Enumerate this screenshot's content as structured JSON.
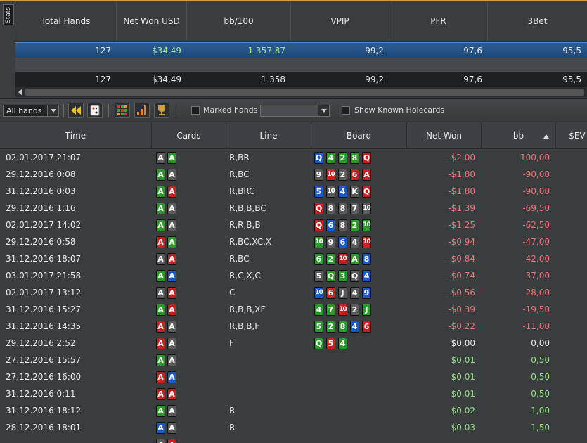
{
  "stats_tab": "Stats",
  "stats": {
    "columns": [
      "Total Hands",
      "Net Won USD",
      "bb/100",
      "VPIP",
      "PFR",
      "3Bet"
    ],
    "row1": [
      "127",
      "$34,49",
      "1 357,87",
      "99,2",
      "97,6",
      "95,5"
    ],
    "row2": [
      "127",
      "$34,49",
      "1 358",
      "99,2",
      "97,6",
      "95,5"
    ]
  },
  "toolbar": {
    "filter_value": "All hands",
    "marked_hands_label": "Marked hands",
    "marked_hands_value": "",
    "show_known_label": "Show Known Holecards"
  },
  "table": {
    "columns": [
      "Time",
      "Cards",
      "Line",
      "Board",
      "Net Won",
      "bb",
      "$EV"
    ],
    "rows": [
      {
        "time": "02.01.2017 21:07",
        "cards": [
          [
            "A",
            "s"
          ],
          [
            "A",
            "c"
          ]
        ],
        "line": "R,BR",
        "board": [
          [
            "Q",
            "d"
          ],
          [
            "4",
            "c"
          ],
          [
            "2",
            "c"
          ],
          [
            "8",
            "c"
          ],
          [
            "Q",
            "h"
          ]
        ],
        "net": "-$2,00",
        "bb": "-100,00",
        "cls": "neg"
      },
      {
        "time": "29.12.2016 0:08",
        "cards": [
          [
            "A",
            "c"
          ],
          [
            "A",
            "s"
          ]
        ],
        "line": "R,BC",
        "board": [
          [
            "9",
            "s"
          ],
          [
            "10",
            "h"
          ],
          [
            "2",
            "s"
          ],
          [
            "6",
            "h"
          ],
          [
            "A",
            "h"
          ]
        ],
        "net": "-$1,80",
        "bb": "-90,00",
        "cls": "neg"
      },
      {
        "time": "31.12.2016 0:03",
        "cards": [
          [
            "A",
            "c"
          ],
          [
            "A",
            "h"
          ]
        ],
        "line": "R,BRC",
        "board": [
          [
            "5",
            "d"
          ],
          [
            "10",
            "s"
          ],
          [
            "4",
            "d"
          ],
          [
            "K",
            "s"
          ],
          [
            "Q",
            "h"
          ]
        ],
        "net": "-$1,80",
        "bb": "-90,00",
        "cls": "neg"
      },
      {
        "time": "29.12.2016 1:16",
        "cards": [
          [
            "A",
            "c"
          ],
          [
            "A",
            "s"
          ]
        ],
        "line": "R,B,B,BC",
        "board": [
          [
            "Q",
            "h"
          ],
          [
            "8",
            "s"
          ],
          [
            "8",
            "s"
          ],
          [
            "7",
            "s"
          ],
          [
            "10",
            "s"
          ]
        ],
        "net": "-$1,39",
        "bb": "-69,50",
        "cls": "neg"
      },
      {
        "time": "02.01.2017 14:02",
        "cards": [
          [
            "A",
            "c"
          ],
          [
            "A",
            "s"
          ]
        ],
        "line": "R,R,B,B",
        "board": [
          [
            "Q",
            "h"
          ],
          [
            "6",
            "d"
          ],
          [
            "8",
            "s"
          ],
          [
            "2",
            "c"
          ],
          [
            "10",
            "c"
          ]
        ],
        "net": "-$1,25",
        "bb": "-62,50",
        "cls": "neg"
      },
      {
        "time": "29.12.2016 0:58",
        "cards": [
          [
            "A",
            "h"
          ],
          [
            "A",
            "c"
          ]
        ],
        "line": "R,BC,XC,X",
        "board": [
          [
            "10",
            "c"
          ],
          [
            "9",
            "s"
          ],
          [
            "6",
            "d"
          ],
          [
            "4",
            "s"
          ],
          [
            "10",
            "h"
          ]
        ],
        "net": "-$0,94",
        "bb": "-47,00",
        "cls": "neg"
      },
      {
        "time": "31.12.2016 18:07",
        "cards": [
          [
            "A",
            "s"
          ],
          [
            "A",
            "h"
          ]
        ],
        "line": "R,BC",
        "board": [
          [
            "6",
            "c"
          ],
          [
            "2",
            "c"
          ],
          [
            "10",
            "h"
          ],
          [
            "A",
            "c"
          ],
          [
            "8",
            "d"
          ]
        ],
        "net": "-$0,84",
        "bb": "-42,00",
        "cls": "neg"
      },
      {
        "time": "03.01.2017 21:58",
        "cards": [
          [
            "A",
            "c"
          ],
          [
            "A",
            "d"
          ]
        ],
        "line": "R,C,X,C",
        "board": [
          [
            "5",
            "s"
          ],
          [
            "Q",
            "c"
          ],
          [
            "3",
            "c"
          ],
          [
            "Q",
            "s"
          ],
          [
            "4",
            "d"
          ]
        ],
        "net": "-$0,74",
        "bb": "-37,00",
        "cls": "neg"
      },
      {
        "time": "02.01.2017 13:12",
        "cards": [
          [
            "A",
            "s"
          ],
          [
            "A",
            "h"
          ]
        ],
        "line": "C",
        "board": [
          [
            "10",
            "d"
          ],
          [
            "6",
            "h"
          ],
          [
            "J",
            "s"
          ],
          [
            "4",
            "s"
          ],
          [
            "9",
            "d"
          ]
        ],
        "net": "-$0,56",
        "bb": "-28,00",
        "cls": "neg"
      },
      {
        "time": "31.12.2016 15:27",
        "cards": [
          [
            "A",
            "c"
          ],
          [
            "A",
            "h"
          ]
        ],
        "line": "R,B,B,XF",
        "board": [
          [
            "4",
            "c"
          ],
          [
            "7",
            "c"
          ],
          [
            "10",
            "h"
          ],
          [
            "2",
            "s"
          ],
          [
            "J",
            "c"
          ]
        ],
        "net": "-$0,39",
        "bb": "-19,50",
        "cls": "neg"
      },
      {
        "time": "31.12.2016 14:35",
        "cards": [
          [
            "A",
            "h"
          ],
          [
            "A",
            "s"
          ]
        ],
        "line": "R,B,B,F",
        "board": [
          [
            "5",
            "c"
          ],
          [
            "2",
            "c"
          ],
          [
            "8",
            "c"
          ],
          [
            "4",
            "d"
          ],
          [
            "6",
            "h"
          ]
        ],
        "net": "-$0,22",
        "bb": "-11,00",
        "cls": "neg"
      },
      {
        "time": "29.12.2016 2:52",
        "cards": [
          [
            "A",
            "h"
          ],
          [
            "A",
            "s"
          ]
        ],
        "line": "F",
        "board": [
          [
            "Q",
            "c"
          ],
          [
            "5",
            "h"
          ],
          [
            "4",
            "c"
          ]
        ],
        "net": "$0,00",
        "bb": "0,00",
        "cls": "zero"
      },
      {
        "time": "27.12.2016 15:57",
        "cards": [
          [
            "A",
            "c"
          ],
          [
            "A",
            "s"
          ]
        ],
        "line": "",
        "board": [],
        "net": "$0,01",
        "bb": "0,50",
        "cls": "pos"
      },
      {
        "time": "27.12.2016 16:00",
        "cards": [
          [
            "A",
            "h"
          ],
          [
            "A",
            "d"
          ]
        ],
        "line": "",
        "board": [],
        "net": "$0,01",
        "bb": "0,50",
        "cls": "pos"
      },
      {
        "time": "31.12.2016 0:11",
        "cards": [
          [
            "A",
            "h"
          ],
          [
            "A",
            "h"
          ]
        ],
        "line": "",
        "board": [],
        "net": "$0,01",
        "bb": "0,50",
        "cls": "pos"
      },
      {
        "time": "31.12.2016 18:12",
        "cards": [
          [
            "A",
            "c"
          ],
          [
            "A",
            "s"
          ]
        ],
        "line": "R",
        "board": [],
        "net": "$0,02",
        "bb": "1,00",
        "cls": "pos"
      },
      {
        "time": "28.12.2016 18:01",
        "cards": [
          [
            "A",
            "d"
          ],
          [
            "A",
            "s"
          ]
        ],
        "line": "R",
        "board": [],
        "net": "$0,03",
        "bb": "1,50",
        "cls": "pos"
      },
      {
        "time": "",
        "cards": [
          [
            "A",
            "s"
          ],
          [
            "A",
            "h"
          ]
        ],
        "line": "",
        "board": [],
        "net": "",
        "bb": "",
        "cls": "pos"
      }
    ]
  }
}
